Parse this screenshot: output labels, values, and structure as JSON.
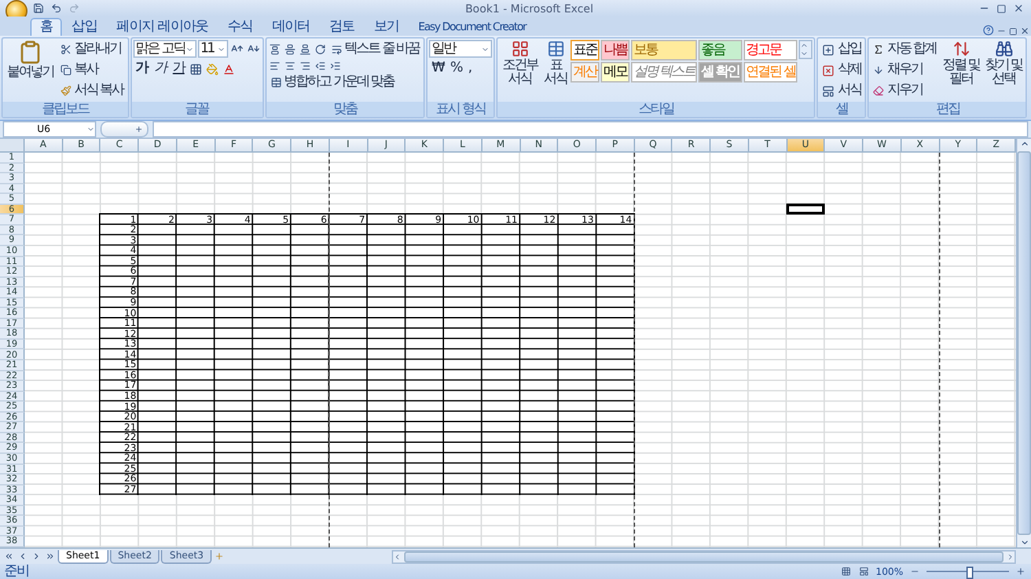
{
  "window": {
    "title": "Book1 - Microsoft Excel"
  },
  "ribbon_tabs": [
    {
      "label": "홈",
      "selected": true
    },
    {
      "label": "삽입",
      "selected": false
    },
    {
      "label": "페이지 레이아웃",
      "selected": false
    },
    {
      "label": "수식",
      "selected": false
    },
    {
      "label": "데이터",
      "selected": false
    },
    {
      "label": "검토",
      "selected": false
    },
    {
      "label": "보기",
      "selected": false
    },
    {
      "label": "Easy Document Creator",
      "selected": false
    }
  ],
  "clipboard": {
    "title": "클립보드",
    "paste": "붙여넣기",
    "cut": "잘라내기",
    "copy": "복사",
    "format_painter": "서식 복사"
  },
  "font": {
    "title": "글꼴",
    "name": "맑은 고딕",
    "size": "11",
    "bold": "가",
    "italic": "가",
    "underline": "가"
  },
  "alignment": {
    "title": "맞춤",
    "wrap_text": "텍스트 줄 바꿈",
    "merge": "병합하고 가운데 맞춤"
  },
  "number": {
    "title": "표시 형식",
    "format": "일반",
    "symbols": [
      "₩",
      "%",
      ","
    ]
  },
  "styles": {
    "title": "스타일",
    "conditional": "조건부 서식",
    "table": "표 서식",
    "cells": [
      {
        "label": "표준",
        "kind": "normal",
        "selected": true
      },
      {
        "label": "나쁨",
        "kind": "bad",
        "selected": false
      },
      {
        "label": "보통",
        "kind": "neutral",
        "selected": false
      },
      {
        "label": "좋음",
        "kind": "good",
        "selected": false
      },
      {
        "label": "경고문",
        "kind": "warning",
        "selected": false
      },
      {
        "label": "계산",
        "kind": "calculation",
        "selected": false
      },
      {
        "label": "메모",
        "kind": "note",
        "selected": false
      },
      {
        "label": "설명 텍스트",
        "kind": "explanatory",
        "selected": false
      },
      {
        "label": "셀 확인",
        "kind": "check",
        "selected": false
      },
      {
        "label": "연결된 셀",
        "kind": "linked",
        "selected": false
      }
    ]
  },
  "cells": {
    "title": "셀",
    "insert": "삽입",
    "delete": "삭제",
    "format": "서식"
  },
  "editing": {
    "title": "편집",
    "autosum": "자동 합계",
    "fill": "채우기",
    "clear": "지우기",
    "sort": "정렬 및 필터",
    "find": "찾기 및 선택"
  },
  "formula_bar": {
    "name_box": "U6"
  },
  "sheet": {
    "columns": [
      {
        "label": "A",
        "selected": false
      },
      {
        "label": "B",
        "selected": false
      },
      {
        "label": "C",
        "selected": false
      },
      {
        "label": "D",
        "selected": false
      },
      {
        "label": "E",
        "selected": false
      },
      {
        "label": "F",
        "selected": false
      },
      {
        "label": "G",
        "selected": false
      },
      {
        "label": "H",
        "selected": false
      },
      {
        "label": "I",
        "selected": false
      },
      {
        "label": "J",
        "selected": false
      },
      {
        "label": "K",
        "selected": false
      },
      {
        "label": "L",
        "selected": false
      },
      {
        "label": "M",
        "selected": false
      },
      {
        "label": "N",
        "selected": false
      },
      {
        "label": "O",
        "selected": false
      },
      {
        "label": "P",
        "selected": false
      },
      {
        "label": "Q",
        "selected": false
      },
      {
        "label": "R",
        "selected": false
      },
      {
        "label": "S",
        "selected": false
      },
      {
        "label": "T",
        "selected": false
      },
      {
        "label": "U",
        "selected": true
      },
      {
        "label": "V",
        "selected": false
      },
      {
        "label": "W",
        "selected": false
      },
      {
        "label": "X",
        "selected": false
      },
      {
        "label": "Y",
        "selected": false
      },
      {
        "label": "Z",
        "selected": false
      }
    ],
    "rows": [
      {
        "label": "1",
        "selected": false
      },
      {
        "label": "2",
        "selected": false
      },
      {
        "label": "3",
        "selected": false
      },
      {
        "label": "4",
        "selected": false
      },
      {
        "label": "5",
        "selected": false
      },
      {
        "label": "6",
        "selected": true
      },
      {
        "label": "7",
        "selected": false
      },
      {
        "label": "8",
        "selected": false
      },
      {
        "label": "9",
        "selected": false
      },
      {
        "label": "10",
        "selected": false
      },
      {
        "label": "11",
        "selected": false
      },
      {
        "label": "12",
        "selected": false
      },
      {
        "label": "13",
        "selected": false
      },
      {
        "label": "14",
        "selected": false
      },
      {
        "label": "15",
        "selected": false
      },
      {
        "label": "16",
        "selected": false
      },
      {
        "label": "17",
        "selected": false
      },
      {
        "label": "18",
        "selected": false
      },
      {
        "label": "19",
        "selected": false
      },
      {
        "label": "20",
        "selected": false
      },
      {
        "label": "21",
        "selected": false
      },
      {
        "label": "22",
        "selected": false
      },
      {
        "label": "23",
        "selected": false
      },
      {
        "label": "24",
        "selected": false
      },
      {
        "label": "25",
        "selected": false
      },
      {
        "label": "26",
        "selected": false
      },
      {
        "label": "27",
        "selected": false
      },
      {
        "label": "28",
        "selected": false
      },
      {
        "label": "29",
        "selected": false
      },
      {
        "label": "30",
        "selected": false
      },
      {
        "label": "31",
        "selected": false
      },
      {
        "label": "32",
        "selected": false
      },
      {
        "label": "33",
        "selected": false
      },
      {
        "label": "34",
        "selected": false
      },
      {
        "label": "35",
        "selected": false
      },
      {
        "label": "36",
        "selected": false
      },
      {
        "label": "37",
        "selected": false
      },
      {
        "label": "38",
        "selected": false
      }
    ],
    "table": {
      "top_row": [
        "1",
        "2",
        "3",
        "4",
        "5",
        "6",
        "7",
        "8",
        "9",
        "10",
        "11",
        "12",
        "13",
        "14"
      ],
      "left_column": [
        "2",
        "3",
        "4",
        "5",
        "6",
        "7",
        "8",
        "9",
        "10",
        "11",
        "12",
        "13",
        "14",
        "15",
        "16",
        "17",
        "18",
        "19",
        "20",
        "21",
        "22",
        "23",
        "24",
        "25",
        "26",
        "27"
      ]
    }
  },
  "sheet_tabs": [
    {
      "label": "Sheet1",
      "selected": true
    },
    {
      "label": "Sheet2",
      "selected": false
    },
    {
      "label": "Sheet3",
      "selected": false
    }
  ],
  "status_bar": {
    "state": "준비",
    "zoom": "100%",
    "zoom_slider": {
      "level": 0.5
    }
  }
}
